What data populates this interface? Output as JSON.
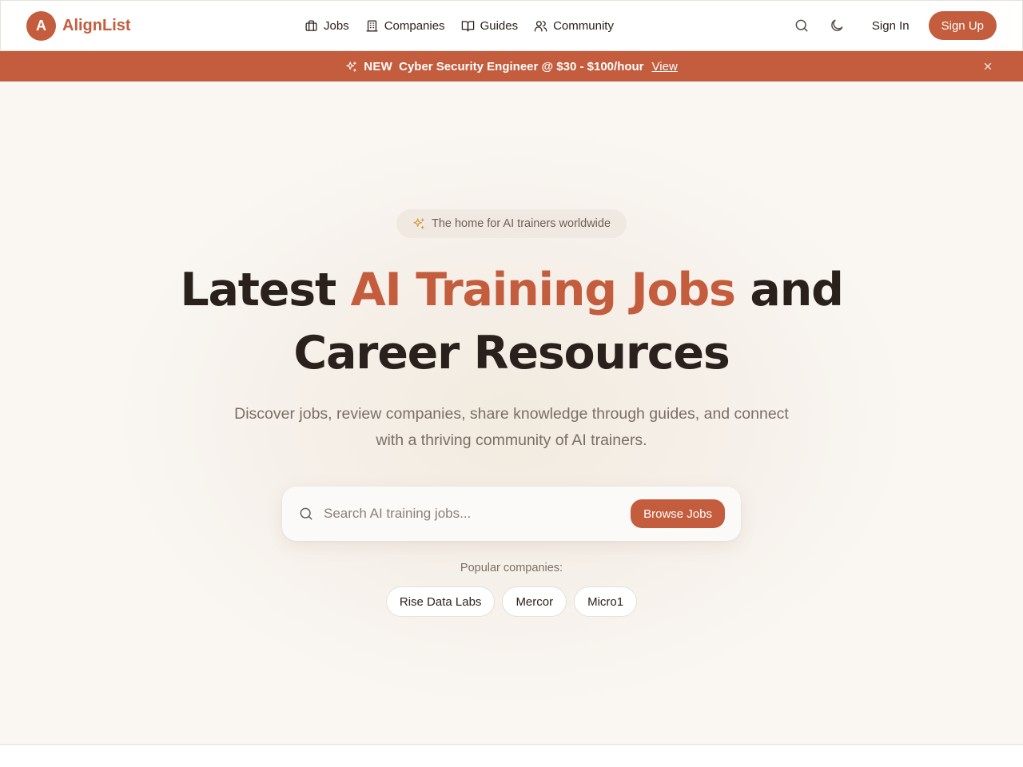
{
  "brand": {
    "mark": "A",
    "name": "AlignList",
    "color": "#c35d3e"
  },
  "nav": {
    "items": [
      {
        "label": "Jobs",
        "icon": "briefcase-icon"
      },
      {
        "label": "Companies",
        "icon": "building-icon"
      },
      {
        "label": "Guides",
        "icon": "book-icon"
      },
      {
        "label": "Community",
        "icon": "users-icon"
      }
    ]
  },
  "header": {
    "search_icon": "search-icon",
    "theme_icon": "moon-icon",
    "sign_in": "Sign In",
    "sign_up": "Sign Up"
  },
  "banner": {
    "icon": "sparkles-icon",
    "tag": "NEW",
    "text": "Cyber Security Engineer @ $30 - $100/hour",
    "link": "View",
    "close_icon": "close-icon"
  },
  "hero": {
    "pill": "The home for AI trainers worldwide",
    "title_before": "Latest ",
    "title_accent": "AI Training Jobs",
    "title_after": " and Career Resources",
    "subtitle": "Discover jobs, review companies, share knowledge through guides, and connect with a thriving community of AI trainers.",
    "search_placeholder": "Search AI training jobs...",
    "search_value": "",
    "browse_button": "Browse Jobs",
    "popular_label": "Popular companies:",
    "popular_companies": [
      "Rise Data Labs",
      "Mercor",
      "Micro1"
    ]
  },
  "colors": {
    "accent": "#c35d3e",
    "background": "#faf7f3",
    "text": "#2a211c",
    "muted": "#7a6f67"
  }
}
